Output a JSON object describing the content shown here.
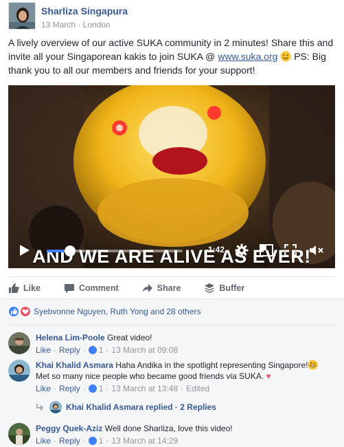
{
  "post": {
    "author": "Sharliza Singapura",
    "meta": "13 March · London",
    "text_before_link": "A lively overview of our active SUKA community in 2 minutes! Share this and invite all your Singaporean kakis to join SUKA @ ",
    "link": "www.suka.org",
    "text_after_link": " PS: Big thank you to all our members and friends for your support!"
  },
  "video": {
    "overlay_title": "AND WE ARE ALIVE AS EVER!",
    "time_remaining": "-1:42",
    "progress": 0.17
  },
  "actions": {
    "like": "Like",
    "comment": "Comment",
    "share": "Share",
    "buffer": "Buffer"
  },
  "reactions": {
    "summary": "Syebvonne Nguyen, Ruth Yong and 28 others"
  },
  "comments": [
    {
      "name": "Helena Lim-Poole",
      "text": "Great video!",
      "like": "Like",
      "reply": "Reply",
      "likes": "1",
      "time": "13 March at 09:08",
      "edited": ""
    },
    {
      "name": "Khai Khalid Asmara",
      "text": "Haha Andika in the spotlight representing Singapore!",
      "text2": "Met so many nice people who became good friends via SUKA.",
      "like": "Like",
      "reply": "Reply",
      "likes": "1",
      "time": "13 March at 13:48",
      "edited": "Edited"
    },
    {
      "name": "Peggy Quek-Aziz",
      "text": "Well done Sharliza, love this video!",
      "like": "Like",
      "reply": "Reply",
      "likes": "1",
      "time": "13 March at 14:29",
      "edited": ""
    }
  ],
  "reply_thread": {
    "text": "Khai Khalid Asmara replied · 2 Replies"
  }
}
